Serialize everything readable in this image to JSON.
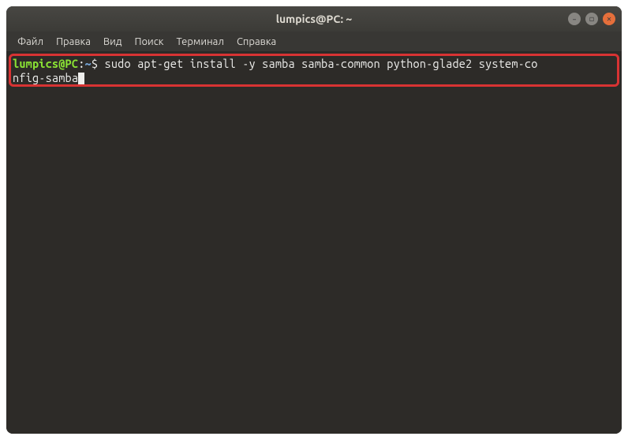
{
  "window": {
    "title": "lumpics@PC: ~"
  },
  "menubar": {
    "items": [
      {
        "label": "Файл"
      },
      {
        "label": "Правка"
      },
      {
        "label": "Вид"
      },
      {
        "label": "Поиск"
      },
      {
        "label": "Терминал"
      },
      {
        "label": "Справка"
      }
    ]
  },
  "terminal": {
    "prompt_user": "lumpics@PC",
    "prompt_sep": ":",
    "prompt_path": "~",
    "prompt_dollar": "$ ",
    "command_line1": "sudo apt-get install -y samba samba-common python-glade2 system-co",
    "command_line2": "nfig-samba"
  },
  "icons": {
    "minimize": "–",
    "maximize": "◻",
    "close": "✕"
  },
  "colors": {
    "titlebar_bg": "#3c3b37",
    "terminal_bg": "#2d2b28",
    "prompt_green": "#8ae234",
    "prompt_blue": "#729fcf",
    "text": "#eeeeec",
    "close_btn": "#e66f3b",
    "highlight": "#d83333"
  }
}
